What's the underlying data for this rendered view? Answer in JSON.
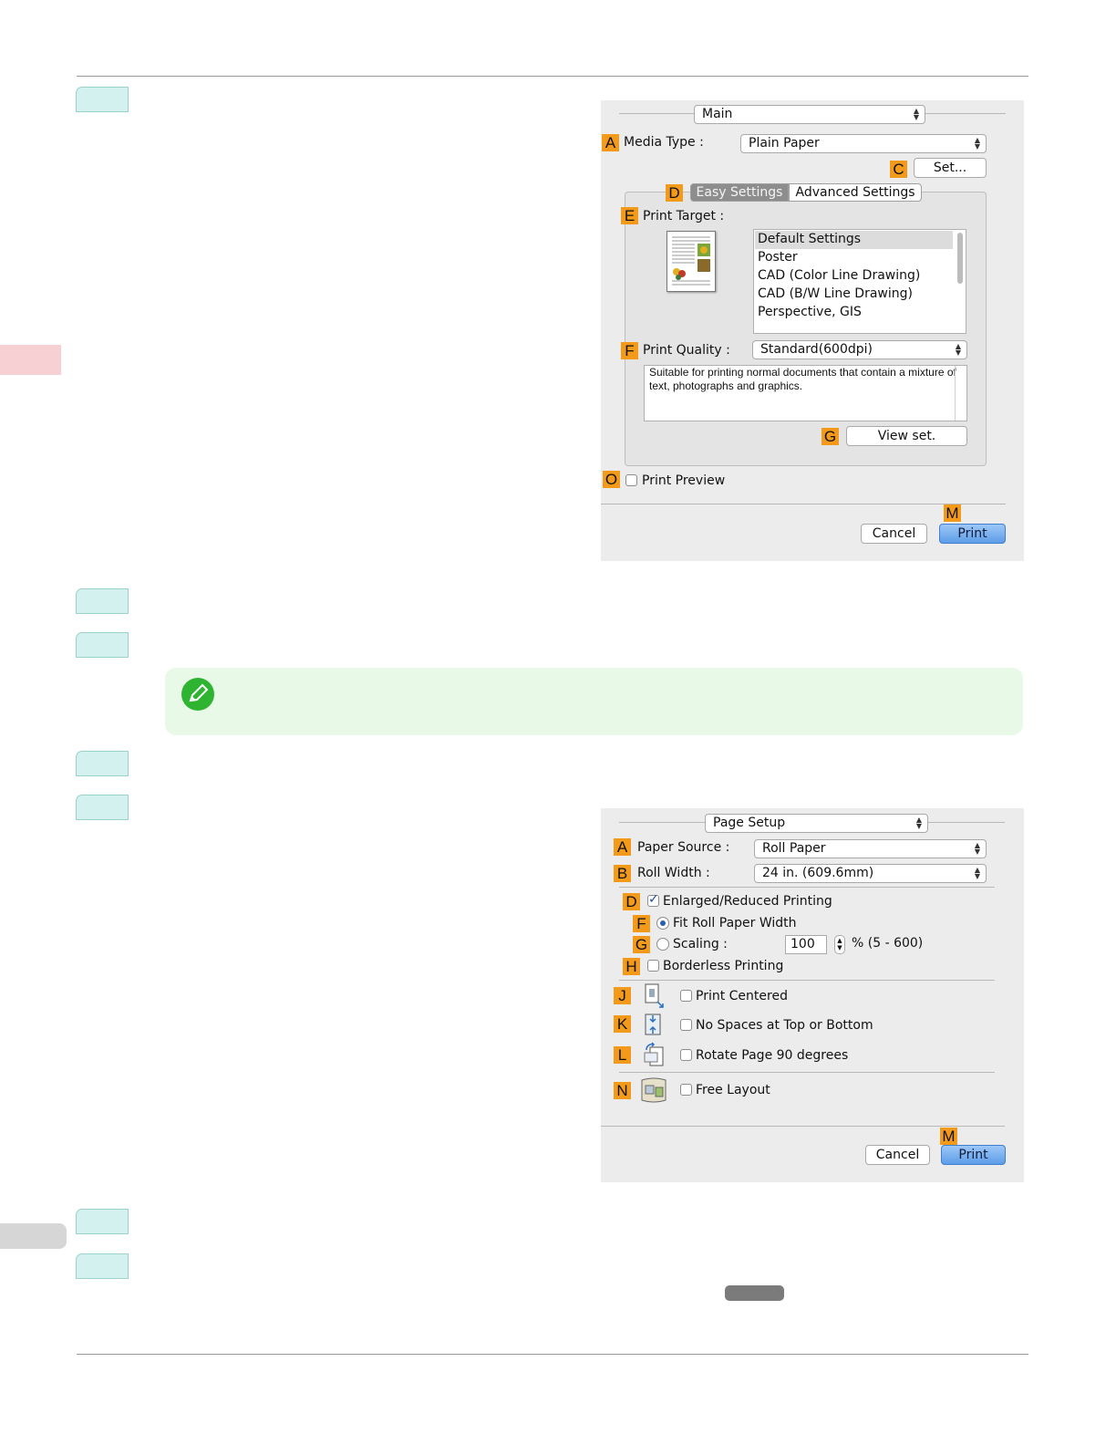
{
  "dialog_main": {
    "panel_select": "Main",
    "media_type": {
      "badge": "A",
      "label": "Media Type :",
      "value": "Plain Paper"
    },
    "set_button": {
      "badge": "C",
      "label": "Set..."
    },
    "tabs": {
      "badge": "D",
      "items": [
        "Easy Settings",
        "Advanced Settings"
      ],
      "active": "Easy Settings"
    },
    "print_target": {
      "badge": "E",
      "label": "Print Target :",
      "items": [
        "Default Settings",
        "Poster",
        "CAD (Color Line Drawing)",
        "CAD (B/W Line Drawing)",
        "Perspective, GIS"
      ],
      "selected": "Default Settings"
    },
    "print_quality": {
      "badge": "F",
      "label": "Print Quality :",
      "value": "Standard(600dpi)"
    },
    "description": "Suitable for printing normal documents that contain a mixture of text, photographs and graphics.",
    "view_set": {
      "badge": "G",
      "label": "View set."
    },
    "print_preview": {
      "badge": "O",
      "label": "Print Preview",
      "checked": false
    },
    "print_badge": "M",
    "cancel_label": "Cancel",
    "print_label": "Print"
  },
  "dialog_page_setup": {
    "panel_select": "Page Setup",
    "paper_source": {
      "badge": "A",
      "label": "Paper Source :",
      "value": "Roll Paper"
    },
    "roll_width": {
      "badge": "B",
      "label": "Roll Width :",
      "value": "24 in. (609.6mm)"
    },
    "enlarged": {
      "badge": "D",
      "label": "Enlarged/Reduced Printing",
      "checked": true
    },
    "fit_roll": {
      "badge": "F",
      "label": "Fit Roll Paper Width",
      "selected": true
    },
    "scaling": {
      "badge": "G",
      "label": "Scaling :",
      "value": "100",
      "range": "% (5 - 600)",
      "selected": false
    },
    "borderless": {
      "badge": "H",
      "label": "Borderless Printing",
      "checked": false
    },
    "print_centered": {
      "badge": "J",
      "label": "Print Centered",
      "checked": false,
      "icon": "print-centered-icon"
    },
    "no_spaces": {
      "badge": "K",
      "label": "No Spaces at Top or Bottom",
      "checked": false,
      "icon": "no-spaces-icon"
    },
    "rotate": {
      "badge": "L",
      "label": "Rotate Page 90 degrees",
      "checked": false,
      "icon": "rotate-page-icon"
    },
    "free_layout": {
      "badge": "N",
      "label": "Free Layout",
      "checked": false,
      "icon": "free-layout-icon"
    },
    "print_badge": "M",
    "cancel_label": "Cancel",
    "print_label": "Print"
  },
  "colors": {
    "step_tab": "#d3f1ee",
    "badge": "#f39a1a",
    "note_box": "#e8f9e8",
    "note_icon": "#2fb432",
    "side_tab": "#f7d0d3",
    "primary_button": "#6aa8ee"
  }
}
